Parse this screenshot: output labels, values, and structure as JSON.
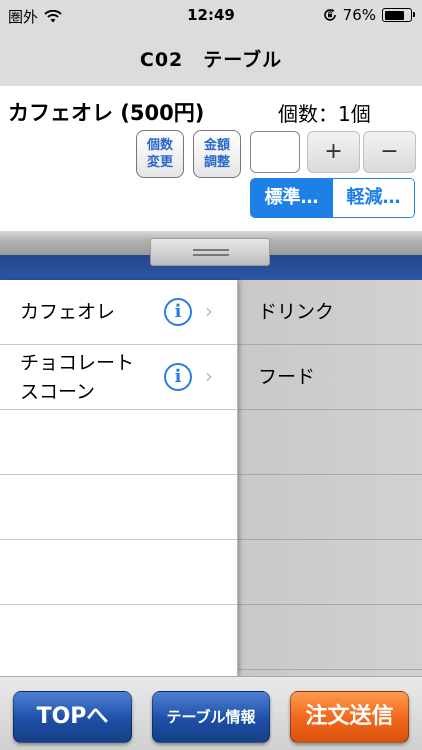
{
  "status_bar": {
    "carrier": "圏外",
    "time": "12:49",
    "battery_percent": "76%",
    "battery_level": 0.76
  },
  "nav": {
    "title": "C02　テーブル"
  },
  "item": {
    "name": "カフェオレ (500円)",
    "quantity_label": "個数：1個",
    "change_qty_button": [
      "個数",
      "変更"
    ],
    "adjust_price_button": [
      "金額",
      "調整"
    ],
    "quantity_input_value": "",
    "plus_label": "+",
    "minus_label": "−"
  },
  "tax_toggle": {
    "standard_label": "標準…",
    "reduced_label": "軽減…",
    "selected": "standard"
  },
  "menu_items": [
    {
      "lines": [
        "カフェオレ"
      ]
    },
    {
      "lines": [
        "チョコレート",
        "スコーン"
      ]
    }
  ],
  "categories": [
    {
      "label": "ドリンク"
    },
    {
      "label": "フード"
    }
  ],
  "toolbar": {
    "top_label": "TOPへ",
    "table_info_label": "テーブル情報",
    "send_order_label": "注文送信"
  },
  "colors": {
    "accent_blue": "#1e7fe6",
    "toolbar_blue": "#1d4fa6",
    "toolbar_orange": "#f0661a",
    "header_band": "#2e5aa6"
  }
}
